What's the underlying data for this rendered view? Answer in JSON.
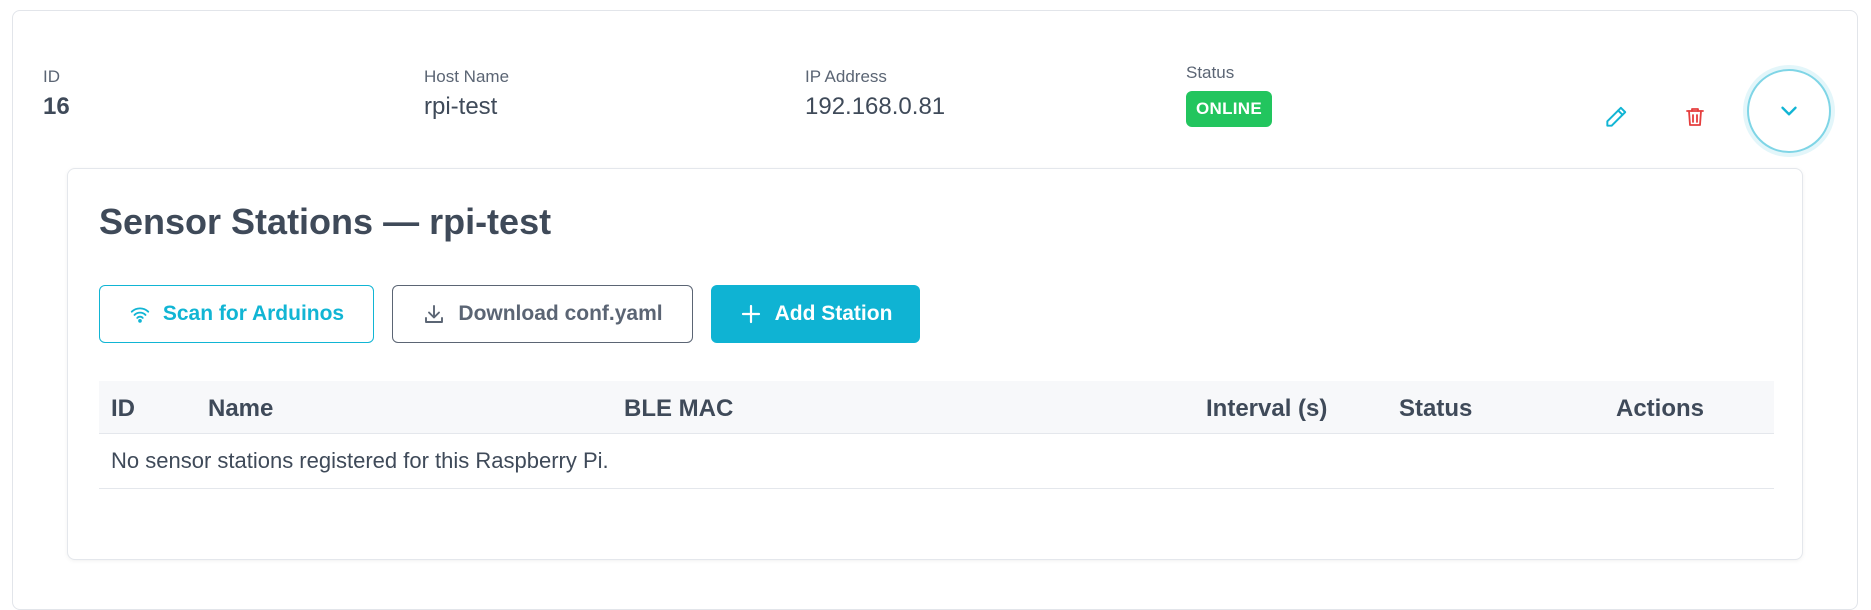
{
  "pi": {
    "id_label": "ID",
    "id_value": "16",
    "host_label": "Host Name",
    "host_value": "rpi-test",
    "ip_label": "IP Address",
    "ip_value": "192.168.0.81",
    "status_label": "Status",
    "status_value": "ONLINE"
  },
  "colors": {
    "accent": "#11b5d4",
    "online": "#22c55e",
    "danger": "#e53e3e"
  },
  "stations": {
    "title": "Sensor Stations — rpi-test",
    "scan_label": "Scan for Arduinos",
    "download_label": "Download conf.yaml",
    "add_label": "Add Station",
    "columns": [
      "ID",
      "Name",
      "BLE MAC",
      "Interval (s)",
      "Status",
      "Actions"
    ],
    "empty_message": "No sensor stations registered for this Raspberry Pi."
  }
}
